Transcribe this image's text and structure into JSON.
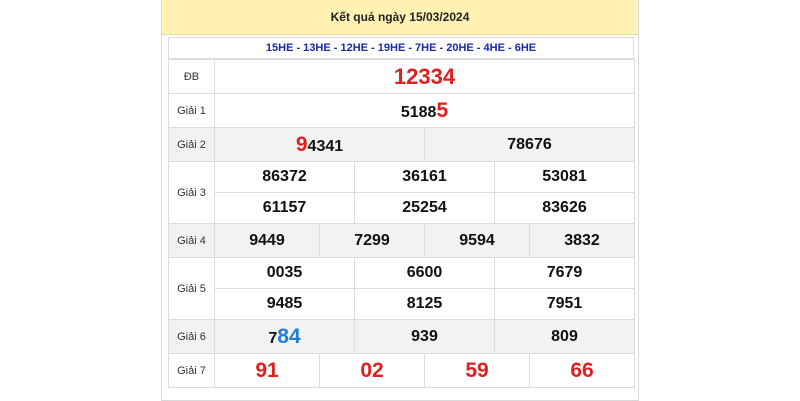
{
  "title": "Kết quả ngày 15/03/2024",
  "codes": "15HE - 13HE - 12HE - 19HE - 7HE - 20HE - 4HE - 6HE",
  "labels": {
    "db": "ĐB",
    "g1": "Giải 1",
    "g2": "Giải 2",
    "g3": "Giải 3",
    "g4": "Giải 4",
    "g5": "Giải 5",
    "g6": "Giải 6",
    "g7": "Giải 7"
  },
  "db": "12334",
  "g1": {
    "main": "5188",
    "accent": "5"
  },
  "g2": [
    {
      "accent": "9",
      "main": "4341"
    },
    {
      "main": "78676"
    }
  ],
  "g3": [
    "86372",
    "36161",
    "53081",
    "61157",
    "25254",
    "83626"
  ],
  "g4": [
    "9449",
    "7299",
    "9594",
    "3832"
  ],
  "g5": [
    "0035",
    "6600",
    "7679",
    "9485",
    "8125",
    "7951"
  ],
  "g6": [
    {
      "main": "7",
      "accent": "84"
    },
    {
      "main": "939"
    },
    {
      "main": "809"
    }
  ],
  "g7": [
    "91",
    "02",
    "59",
    "66"
  ],
  "colors": {
    "header_bg": "#fff2b3",
    "red": "#e02020",
    "blue": "#1e7fd6",
    "code_blue": "#1a2aa8",
    "grey_row": "#f2f2f2"
  }
}
